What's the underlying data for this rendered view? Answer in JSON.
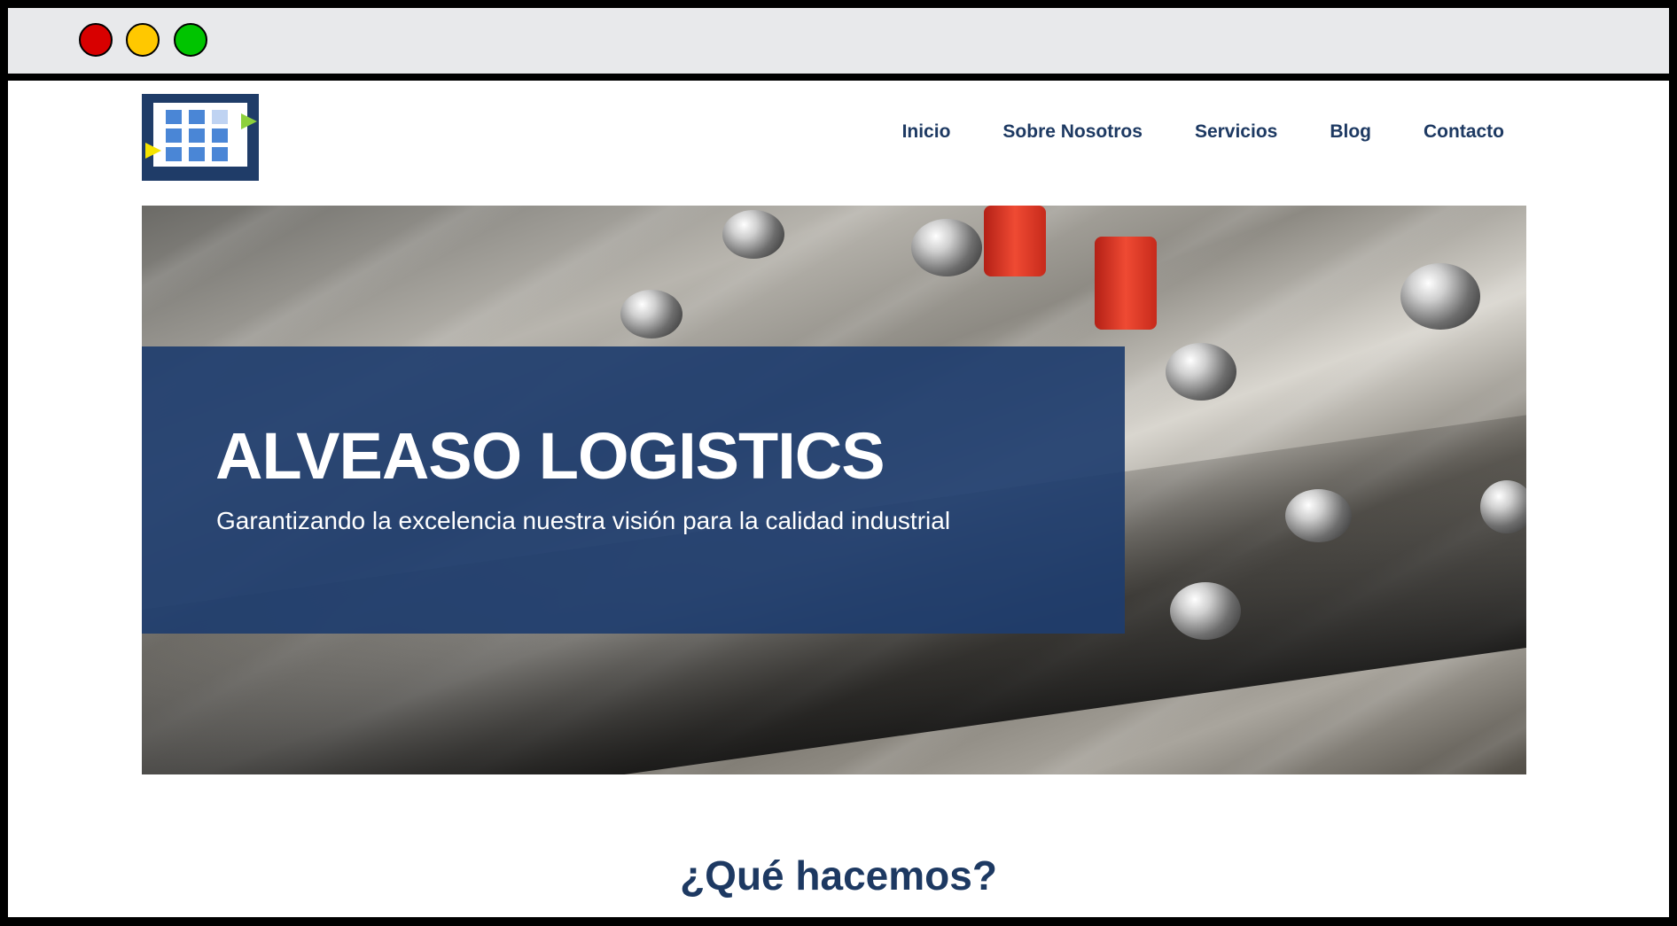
{
  "window": {
    "controls": [
      "close",
      "minimize",
      "maximize"
    ],
    "control_colors": {
      "close": "#d80000",
      "minimize": "#ffc800",
      "maximize": "#00c400"
    }
  },
  "header": {
    "logo_icon": "grid-logo-icon",
    "nav": [
      {
        "label": "Inicio"
      },
      {
        "label": "Sobre Nosotros"
      },
      {
        "label": "Servicios"
      },
      {
        "label": "Blog"
      },
      {
        "label": "Contacto"
      }
    ]
  },
  "hero": {
    "title": "ALVEASO LOGISTICS",
    "subtitle": "Garantizando la excelencia nuestra visión para la calidad industrial",
    "overlay_color": "#1e3d6e"
  },
  "section": {
    "title": "¿Qué hacemos?"
  },
  "colors": {
    "brand": "#1d3962",
    "logo_bg": "#1f3c68",
    "logo_cells": "#4a86d6",
    "logo_arrow_left": "#f6e400",
    "logo_arrow_right": "#8dd03c"
  }
}
